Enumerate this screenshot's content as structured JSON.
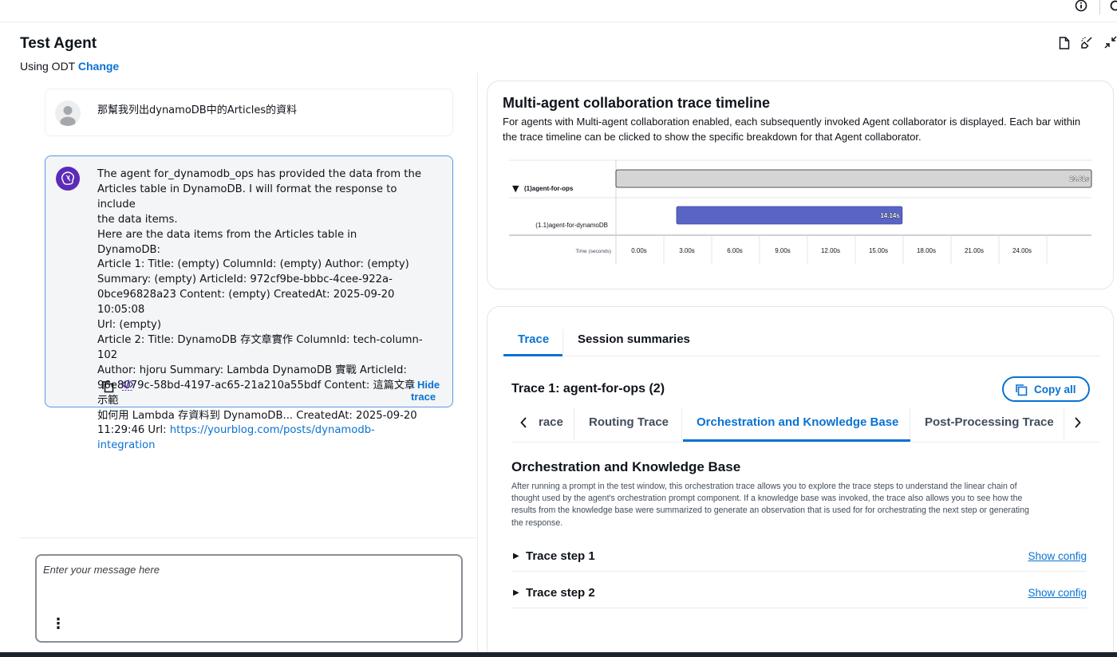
{
  "header": {
    "title": "Test Agent",
    "using_prefix": "Using ODT",
    "change_link": "Change"
  },
  "chat": {
    "user_message": "那幫我列出dynamoDB中的Articles的資料",
    "agent_lines": [
      "The agent for_dynamodb_ops has provided the data from the",
      "Articles table in DynamoDB. I will format the response to include",
      "the data items.",
      "Here are the data items from the Articles table in DynamoDB:",
      "Article 1: Title: (empty) ColumnId: (empty) Author: (empty)",
      "Summary: (empty) ArticleId: 972cf9be-bbbc-4cee-922a-",
      "0bce96828a23 Content: (empty) CreatedAt: 2025-09-20 10:05:08",
      "Url: (empty)",
      "Article 2: Title: DynamoDB 存文章實作 ColumnId: tech-column-102",
      "Author: hjoru Summary: Lambda DynamoDB 實戰 ArticleId:",
      "96e8079c-58bd-4197-ac65-21a210a55bdf Content: 這篇文章示範",
      "如何用 Lambda 存資料到 DynamoDB... CreatedAt: 2025-09-20"
    ],
    "agent_last_prefix": "11:29:46 Url: ",
    "agent_link": "https://yourblog.com/posts/dynamodb-integration",
    "hide_trace": "Hide trace",
    "input_placeholder": "Enter your message here"
  },
  "timeline_panel": {
    "title": "Multi-agent collaboration trace timeline",
    "description": "For agents with Multi-agent collaboration enabled, each subsequently invoked Agent collaborator is displayed. Each bar within the trace timeline can be clicked to show the specific breakdown for that Agent collaborator."
  },
  "chart_data": {
    "type": "bar",
    "orientation": "horizontal-timeline",
    "categories": [
      "(1)agent-for-ops",
      "(1.1)agent-for-dynamoDB"
    ],
    "series": [
      {
        "starts": [
          0,
          3.8
        ],
        "durations": [
          29.81,
          14.14
        ]
      }
    ],
    "bar_labels": [
      "29.81s",
      "14.14s"
    ],
    "bar_colors": [
      "#d5d5d5",
      "#5965c4"
    ],
    "xlabel": "Time (seconds)",
    "x_ticks": [
      "0.00s",
      "3.00s",
      "6.00s",
      "9.00s",
      "12.00s",
      "15.00s",
      "18.00s",
      "21.00s",
      "24.00s"
    ],
    "xlim": [
      0,
      30
    ],
    "grid": true
  },
  "trace_panel": {
    "tabs": [
      "Trace",
      "Session summaries"
    ],
    "trace_title": "Trace 1: agent-for-ops (2)",
    "copy_all": "Copy all",
    "subtabs": [
      "race",
      "Routing Trace",
      "Orchestration and Knowledge Base",
      "Post-Processing Trace"
    ],
    "section_title": "Orchestration and Knowledge Base",
    "section_desc_lines": [
      "After running a prompt in the test window, this orchestration trace allows you to explore the trace steps to understand the linear chain of",
      "thought used by the agent's orchestration prompt component. If a knowledge base was invoked, the trace also allows you to see how the",
      "results from the knowledge base were summarized to generate an observation that is used for for orchestrating the next step or generating",
      "the response."
    ],
    "steps": [
      {
        "label": "Trace step 1",
        "config": "Show config"
      },
      {
        "label": "Trace step 2",
        "config": "Show config"
      }
    ]
  },
  "colors": {
    "accent": "#0972d3",
    "agent_avatar": "#5c2bb8",
    "timeline_bar_primary": "#d5d5d5",
    "timeline_bar_secondary": "#5965c4"
  },
  "icons": [
    "info-icon",
    "settings-icon",
    "document-icon",
    "broom-icon",
    "collapse-icon",
    "user-avatar",
    "agent-brain-icon",
    "copy-icon",
    "code-icon",
    "chevron-left-icon",
    "chevron-right-icon",
    "triangle-down-icon",
    "triangle-right-icon",
    "more-vertical-icon"
  ]
}
